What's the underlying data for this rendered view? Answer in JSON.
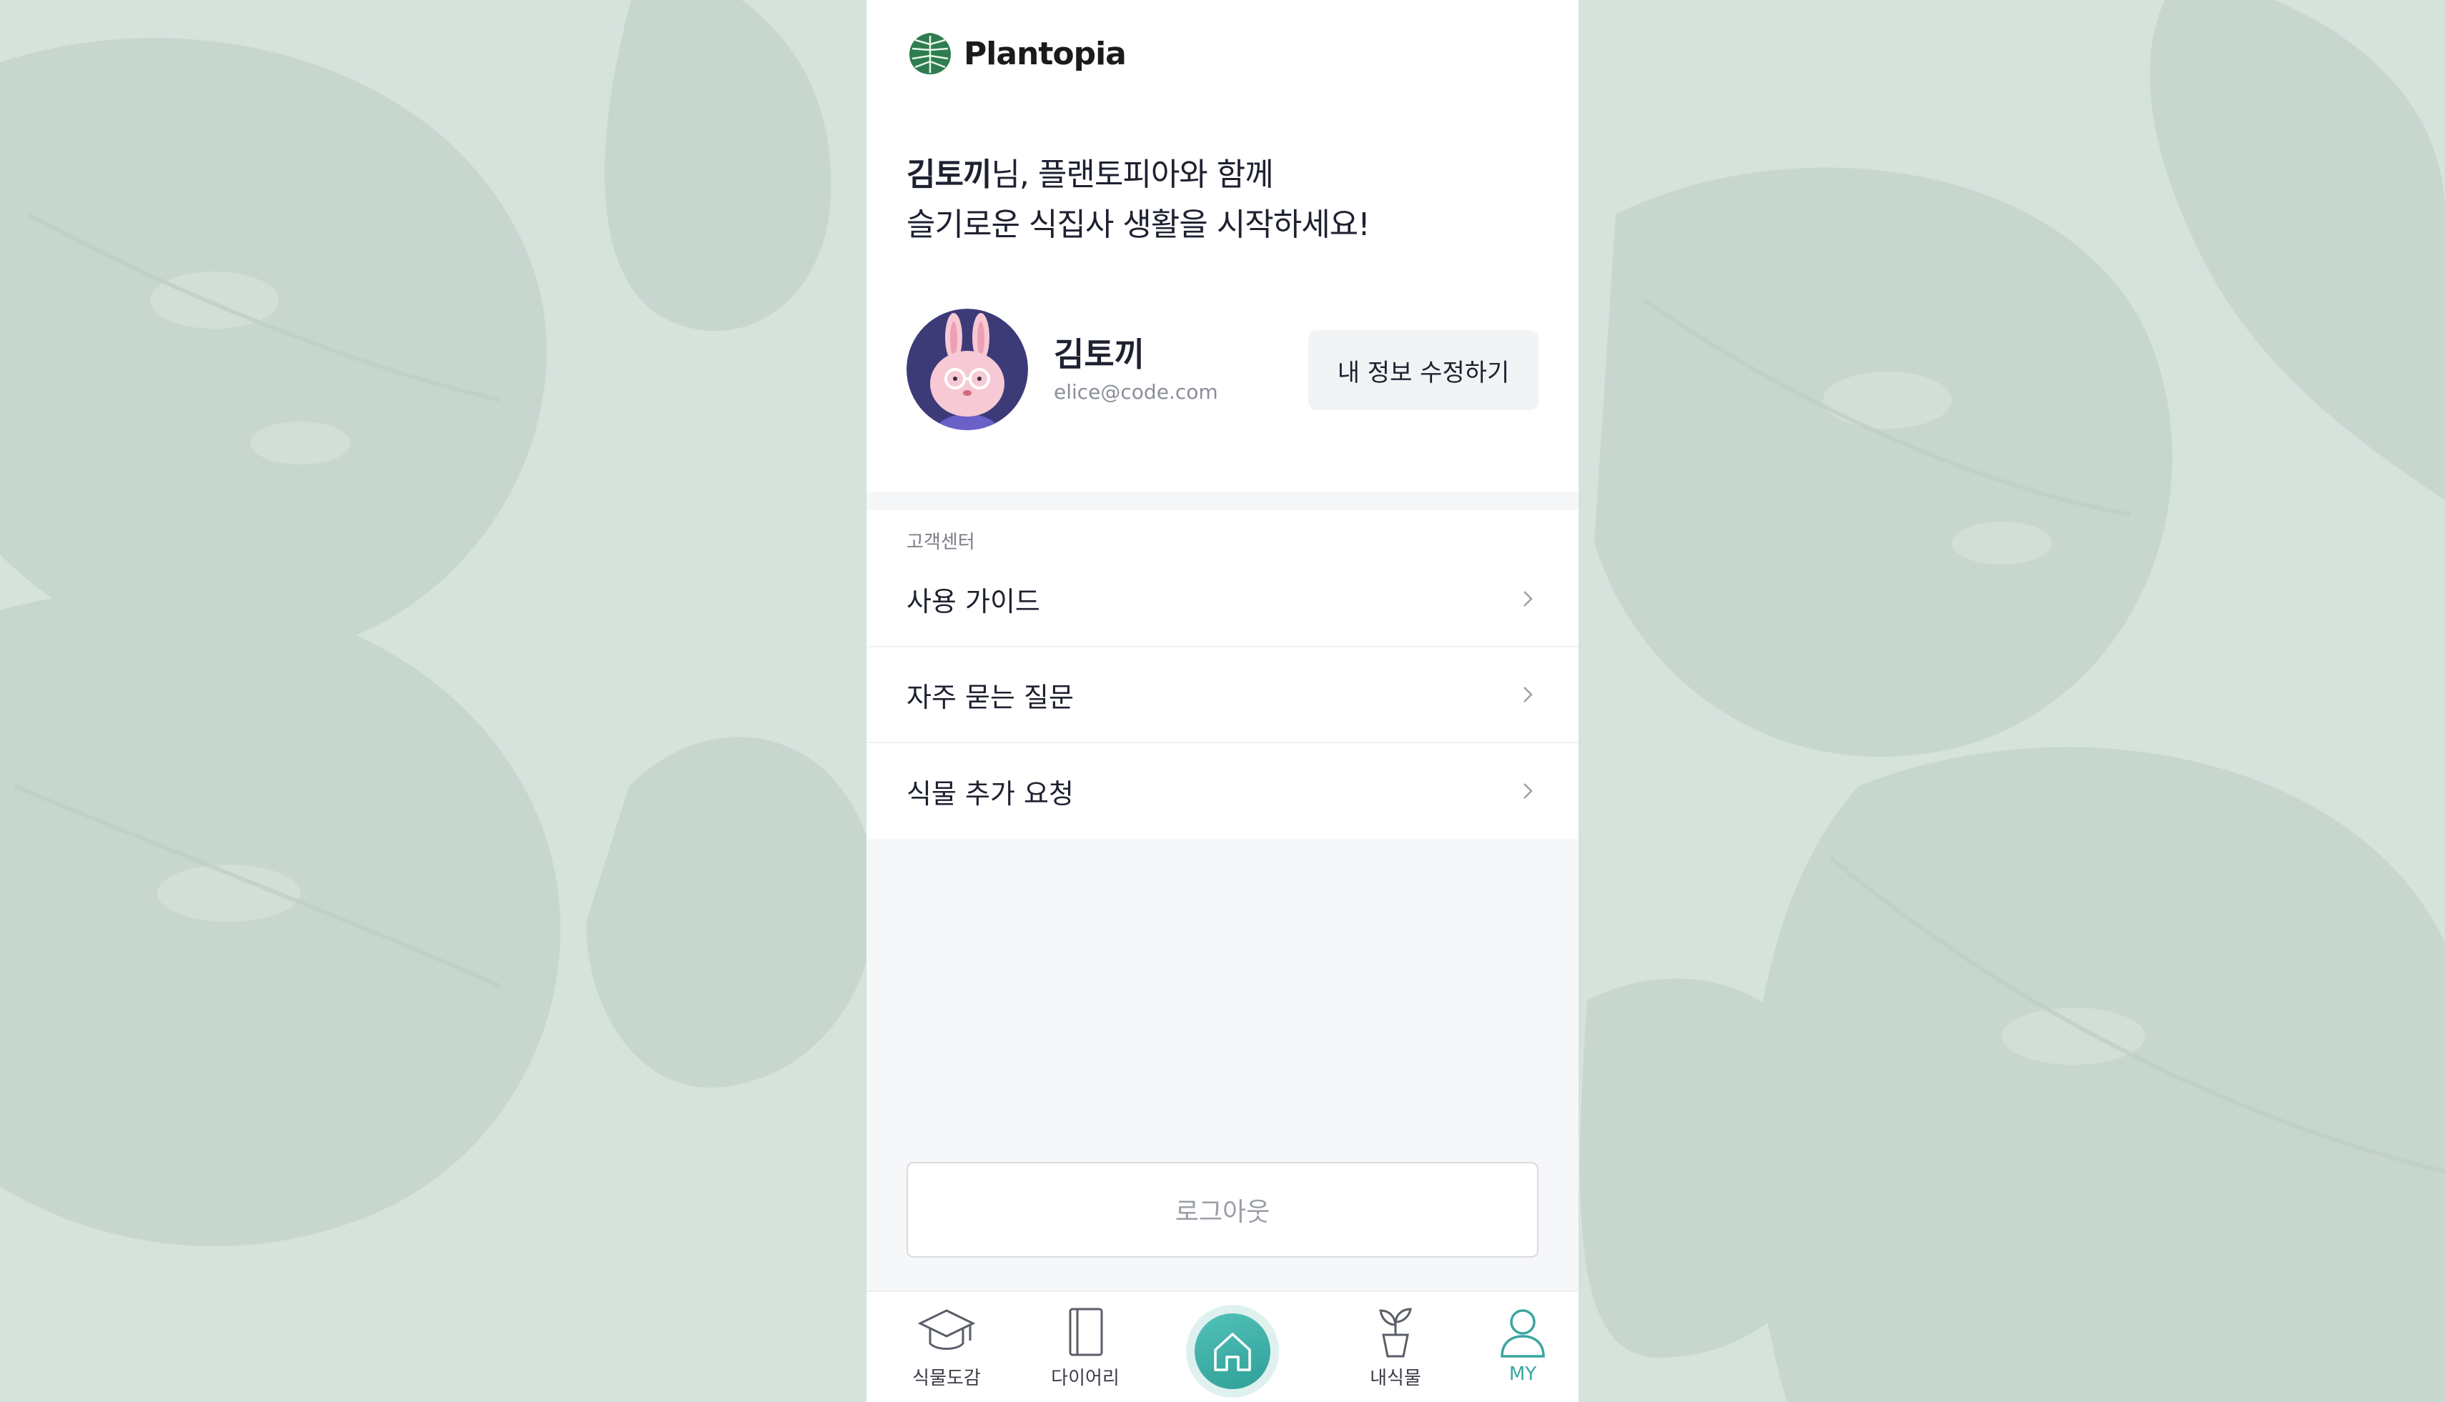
{
  "brand": {
    "name": "Plantopia",
    "accent": "#3aa6a0",
    "logo_icon": "monstera-leaf-icon"
  },
  "greeting": {
    "user_name": "김토끼",
    "line1_rest": "님, 플랜토피아와 함께",
    "line2": "슬기로운 식집사 생활을 시작하세요!"
  },
  "profile": {
    "name": "김토끼",
    "email": "elice@code.com",
    "avatar_icon": "rabbit-avatar-icon",
    "edit_label": "내 정보 수정하기"
  },
  "support": {
    "section_title": "고객센터",
    "items": [
      {
        "label": "사용 가이드"
      },
      {
        "label": "자주 묻는 질문"
      },
      {
        "label": "식물 추가 요청"
      }
    ]
  },
  "logout_label": "로그아웃",
  "tabs": [
    {
      "label": "식물도감",
      "icon": "graduation-cap-icon"
    },
    {
      "label": "다이어리",
      "icon": "notebook-icon"
    },
    {
      "label": "",
      "icon": "home-icon"
    },
    {
      "label": "내식물",
      "icon": "potted-plant-icon"
    },
    {
      "label": "MY",
      "icon": "user-icon",
      "active": true
    }
  ]
}
